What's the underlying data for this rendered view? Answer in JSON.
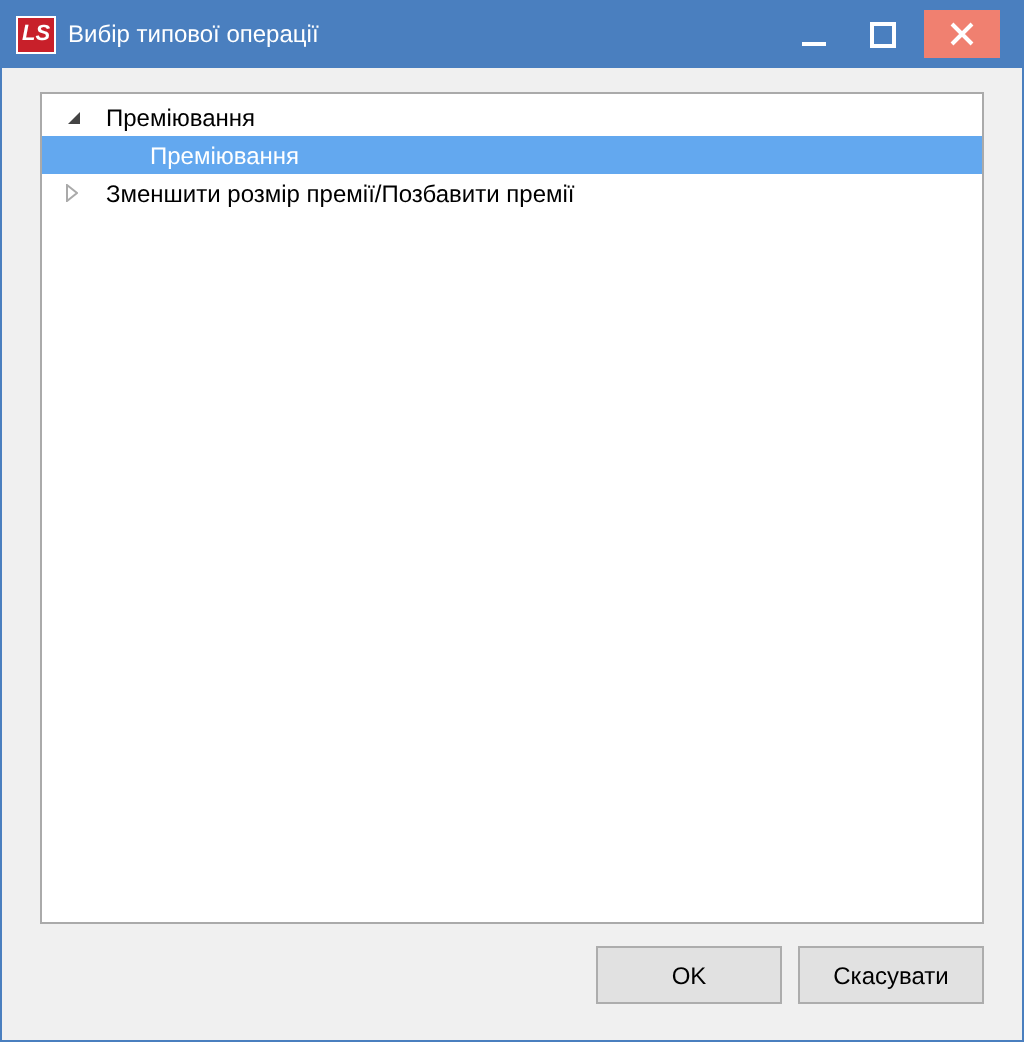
{
  "window": {
    "logo": "LS",
    "title": "Вибір типової операції"
  },
  "tree": [
    {
      "label": "Преміювання",
      "expanded": true,
      "selected": false,
      "children": [
        {
          "label": "Преміювання",
          "selected": true
        }
      ]
    },
    {
      "label": "Зменшити розмір премії/Позбавити премії",
      "expanded": false,
      "selected": false
    }
  ],
  "buttons": [
    "OK",
    "Скасувати"
  ]
}
